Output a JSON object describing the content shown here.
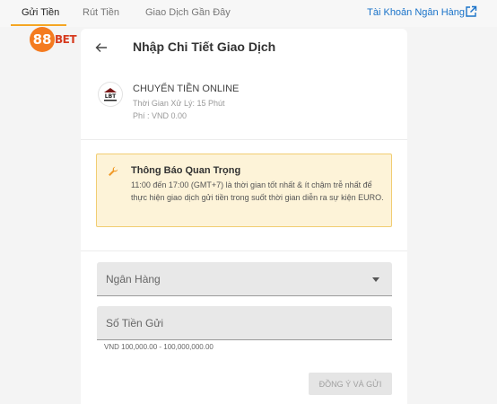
{
  "nav": {
    "tabs": [
      {
        "label": "Gửi Tiền",
        "active": true
      },
      {
        "label": "Rút Tiền",
        "active": false
      },
      {
        "label": "Giao Dịch Gần Đây",
        "active": false
      }
    ],
    "bank_account_link": "Tài Khoản Ngân Hàng"
  },
  "brand": {
    "logo_number": "88",
    "logo_text": "BET"
  },
  "panel": {
    "title": "Nhập Chi Tiết Giao Dịch",
    "method": {
      "logo_text": "LBT",
      "name": "CHUYỂN TIỀN ONLINE",
      "processing_time": "Thời Gian Xử Lý: 15 Phút",
      "fee": "Phí : VND 0.00"
    },
    "notice": {
      "title": "Thông Báo Quan Trọng",
      "body": "11:00 đến 17:00 (GMT+7) là thời gian tốt nhất & ít chậm trễ nhất để thực hiện giao dịch gửi tiền trong suốt thời gian diễn ra sự kiện EURO."
    },
    "bank_select": {
      "label": "Ngân Hàng"
    },
    "amount_input": {
      "label": "Số Tiền Gửi",
      "hint": "VND 100,000.00 - 100,000,000.00"
    },
    "submit_label": "ĐỒNG Ý VÀ GỬI"
  },
  "colors": {
    "accent": "#f5a623",
    "link": "#1a73c9",
    "notice_bg": "#fdf3d8",
    "notice_border": "#f1cd72",
    "logo_orange": "#f47b20"
  }
}
